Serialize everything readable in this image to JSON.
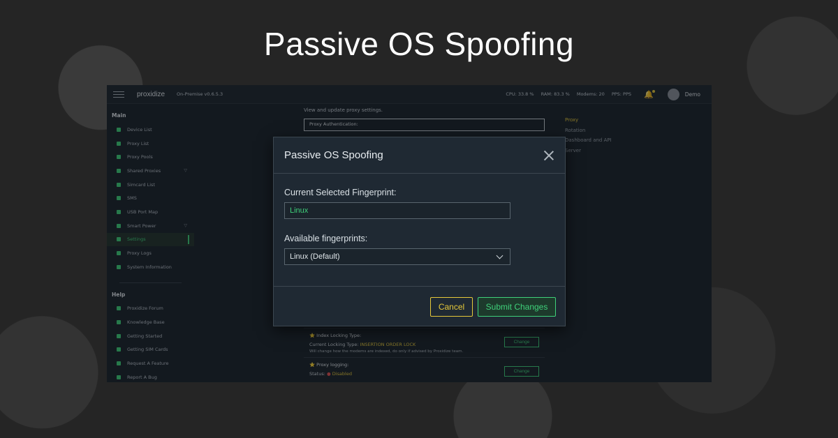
{
  "hero": {
    "title": "Passive OS Spoofing"
  },
  "topbar": {
    "logo": "proxidize",
    "version": "On-Premise v0.6.5.3",
    "cpu": "CPU: 33.8 %",
    "ram": "RAM: 83.3 %",
    "modems": "Modems: 20",
    "pps": "PPS: PPS",
    "user": "Demo"
  },
  "sidebar": {
    "main_title": "Main",
    "main_items": [
      {
        "label": "Device List"
      },
      {
        "label": "Proxy List"
      },
      {
        "label": "Proxy Pools"
      },
      {
        "label": "Shared Proxies"
      },
      {
        "label": "Simcard List"
      },
      {
        "label": "SMS"
      },
      {
        "label": "USB Port Map"
      },
      {
        "label": "Smart Power"
      },
      {
        "label": "Settings"
      },
      {
        "label": "Proxy Logs"
      },
      {
        "label": "System Information"
      }
    ],
    "help_title": "Help",
    "help_items": [
      {
        "label": "Proxidize Forum"
      },
      {
        "label": "Knowledge Base"
      },
      {
        "label": "Getting Started"
      },
      {
        "label": "Getting SIM Cards"
      },
      {
        "label": "Request A Feature"
      },
      {
        "label": "Report A Bug"
      }
    ]
  },
  "content": {
    "intro": "View and update proxy settings.",
    "auth_title": "Proxy Authentication:",
    "index_title": "Index Locking Type:",
    "index_current_label": "Current Locking Type:",
    "index_current_value": "INSERTION ORDER LOCK",
    "index_note": "Will change how the modems are indexed, do only if advised by Proxidize team.",
    "logging_title": "Proxy logging:",
    "logging_status_label": "Status:",
    "logging_status_value": "Disabled",
    "change_label": "Change"
  },
  "right_menu": {
    "items": [
      "Proxy",
      "Rotation",
      "Dashboard and API",
      "Server"
    ]
  },
  "modal": {
    "title": "Passive OS Spoofing",
    "current_label": "Current Selected Fingerprint:",
    "current_value": "Linux",
    "available_label": "Available fingerprints:",
    "selected_option": "Linux (Default)",
    "cancel_label": "Cancel",
    "submit_label": "Submit Changes"
  },
  "colors": {
    "accent_green": "#3fd17a",
    "accent_yellow": "#e6c93a",
    "panel_bg": "#1f2933"
  }
}
